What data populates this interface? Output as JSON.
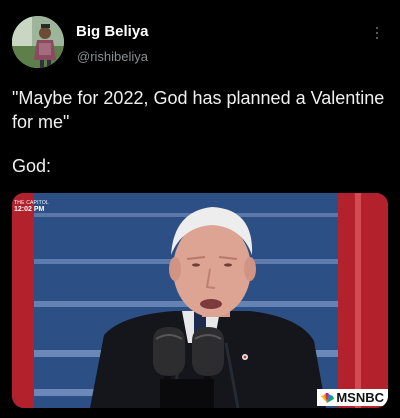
{
  "post": {
    "author": {
      "display_name": "Big Beliya",
      "handle": "@rishibeliya",
      "avatar_icon": "profile-photo"
    },
    "more_icon": "vertical-ellipsis-icon",
    "text": "\"Maybe for 2022, God has planned a Valentine for me\"",
    "caption": "God:"
  },
  "media": {
    "kind": "video-still",
    "broadcast_location": "THE CAPITOL",
    "broadcast_time": "12:02 PM",
    "network_logo": "MSNBC",
    "network_icon": "peacock-icon"
  },
  "colors": {
    "background": "#000000",
    "text": "#e7e9ea",
    "secondary_text": "#8b8f93",
    "flag_blue": "#2c4f86",
    "flag_red": "#b3212c"
  }
}
